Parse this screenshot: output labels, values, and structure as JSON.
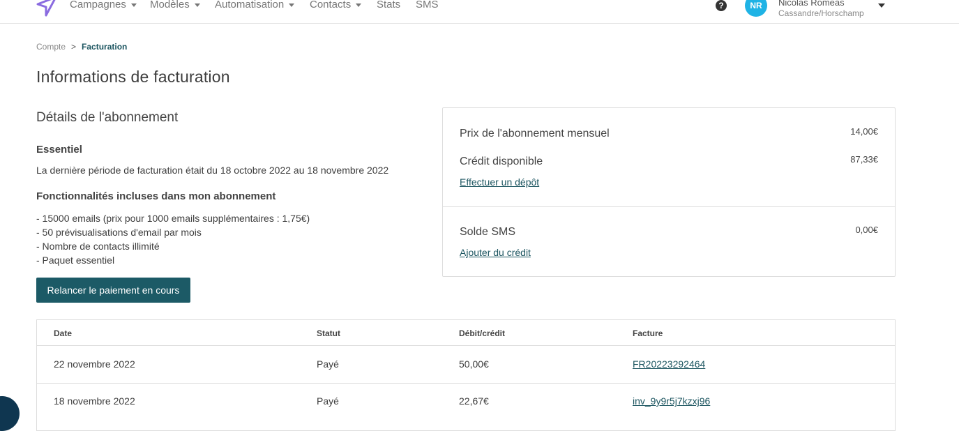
{
  "nav": {
    "items": [
      {
        "label": "Campagnes",
        "dropdown": true
      },
      {
        "label": "Modèles",
        "dropdown": true
      },
      {
        "label": "Automatisation",
        "dropdown": true
      },
      {
        "label": "Contacts",
        "dropdown": true
      },
      {
        "label": "Stats",
        "dropdown": false
      },
      {
        "label": "SMS",
        "dropdown": false
      }
    ],
    "help": "?",
    "user": {
      "initials": "NR",
      "name": "Nicolas Romeas",
      "org": "Cassandre/Horschamp"
    }
  },
  "breadcrumb": {
    "parent": "Compte",
    "separator": ">",
    "current": "Facturation"
  },
  "page_title": "Informations de facturation",
  "subscription": {
    "title": "Détails de l'abonnement",
    "plan": "Essentiel",
    "period": "La dernière période de facturation était du 18 octobre 2022 au 18 novembre 2022",
    "features_title": "Fonctionnalités incluses dans mon abonnement",
    "features": [
      "- 15000 emails (prix pour 1000 emails supplémentaires : 1,75€)",
      "- 50 prévisualisations d'email par mois",
      "- Nombre de contacts illimité",
      "- Paquet essentiel"
    ],
    "retry_button": "Relancer le paiement en cours"
  },
  "summary": {
    "monthly_label": "Prix de l'abonnement mensuel",
    "monthly_value": "14,00€",
    "credit_label": "Crédit disponible",
    "credit_value": "87,33€",
    "deposit_link": "Effectuer un dépôt",
    "sms_label": "Solde SMS",
    "sms_value": "0,00€",
    "sms_link": "Ajouter du crédit"
  },
  "table": {
    "headers": [
      "Date",
      "Statut",
      "Débit/crédit",
      "Facture"
    ],
    "rows": [
      [
        "22 novembre 2022",
        "Payé",
        "50,00€",
        "FR20223292464"
      ],
      [
        "18 novembre 2022",
        "Payé",
        "22,67€",
        "inv_9y9r5j7kzxj96"
      ]
    ]
  }
}
